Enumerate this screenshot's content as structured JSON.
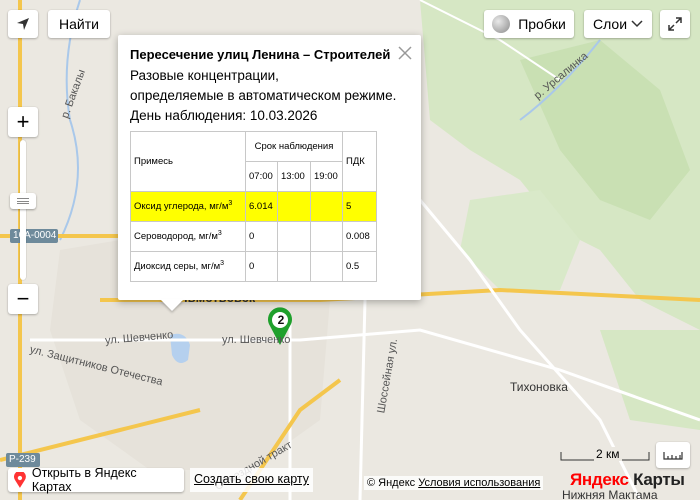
{
  "colors": {
    "accent": "#1fa02c",
    "highlight": "#ffff00",
    "logo_red": "#ff0000"
  },
  "controls": {
    "geolocation_icon": "arrow-icon",
    "find_label": "Найти",
    "traffic_label": "Пробки",
    "layers_label": "Слои",
    "zoom_in_label": "+",
    "zoom_out_label": "−"
  },
  "balloon": {
    "title": "Пересечение улиц Ленина – Строителей",
    "line1": "Разовые концентрации,",
    "line2": "определяемые в автоматическом режиме.",
    "date_line": "День наблюдения: 10.03.2026",
    "table": {
      "col_substance": "Примесь",
      "col_period": "Срок наблюдения",
      "times": [
        "07:00",
        "13:00",
        "19:00"
      ],
      "col_pdk": "ПДК",
      "rows": [
        {
          "name": "Оксид углерода, мг/м",
          "sup": "3",
          "values": [
            "6.014",
            "",
            ""
          ],
          "pdk": "5",
          "highlight": true
        },
        {
          "name": "Сероводород, мг/м",
          "sup": "3",
          "values": [
            "0",
            "",
            ""
          ],
          "pdk": "0.008",
          "highlight": false
        },
        {
          "name": "Диоксид серы, мг/м",
          "sup": "3",
          "values": [
            "0",
            "",
            ""
          ],
          "pdk": "0.5",
          "highlight": false
        }
      ]
    }
  },
  "map": {
    "marker_number": "2",
    "labels": {
      "bakaly": "р. Бакалы",
      "ursalinka": "р. Урсалинка",
      "highway_a0004": "16А-0004",
      "city": "Альметьевск",
      "shevchenko1": "ул. Шевченко",
      "shevchenko2": "ул. Шевченко",
      "zashchitnikov": "ул. Защитников Отечества",
      "shossejnaya": "Шоссейная ул.",
      "tikhonovka": "Тихоновка",
      "r239": "Р-239",
      "trakt": "Объездной тракт",
      "nizhnyaya": "Нижняя Мактама"
    }
  },
  "footer": {
    "open_label": "Открыть в Яндекс Картах",
    "create_label": "Создать свою карту",
    "copyright": "© Яндекс",
    "terms": "Условия использования",
    "logo_ya": "Яндекс",
    "logo_maps": "Карты",
    "scale": "2 км"
  }
}
